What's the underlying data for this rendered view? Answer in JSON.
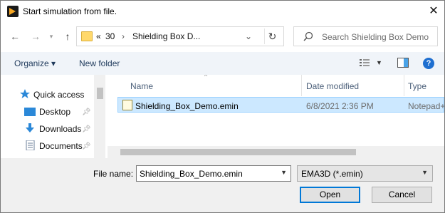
{
  "window": {
    "title": "Start simulation from file."
  },
  "address": {
    "overflow": "«",
    "crumbs": [
      "30",
      "Shielding Box D..."
    ],
    "separator": "›"
  },
  "search": {
    "placeholder": "Search Shielding Box Demo"
  },
  "toolbar": {
    "organize_label": "Organize ▾",
    "new_folder_label": "New folder",
    "help_label": "?"
  },
  "nav_pane": {
    "items": [
      {
        "label": "Quick access",
        "icon": "star-icon"
      },
      {
        "label": "Desktop",
        "icon": "desktop-icon"
      },
      {
        "label": "Downloads",
        "icon": "download-icon"
      },
      {
        "label": "Documents",
        "icon": "documents-icon"
      }
    ]
  },
  "file_list": {
    "columns": [
      "Name",
      "Date modified",
      "Type"
    ],
    "rows": [
      {
        "name": "Shielding_Box_Demo.emin",
        "date": "6/8/2021 2:36 PM",
        "type": "Notepad++"
      }
    ]
  },
  "bottom": {
    "filename_label": "File name:",
    "filename_value": "Shielding_Box_Demo.emin",
    "file_type": "EMA3D (*.emin)",
    "open_label": "Open",
    "cancel_label": "Cancel"
  },
  "colors": {
    "selection": "#cce8ff",
    "accent": "#0078d7",
    "toolbar_bg": "#f0f4f9"
  }
}
